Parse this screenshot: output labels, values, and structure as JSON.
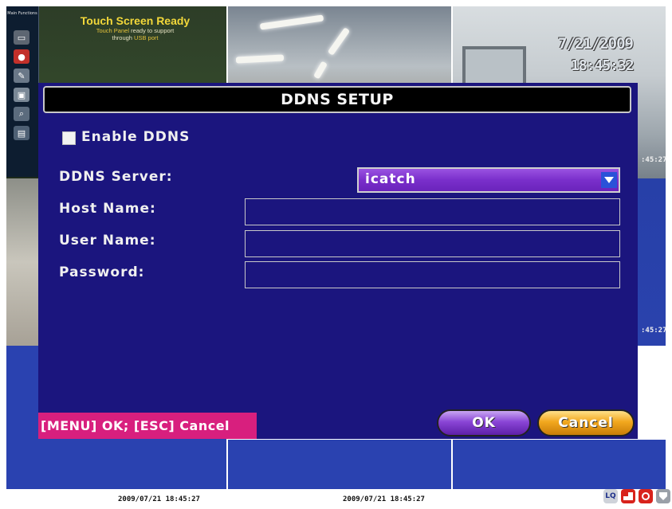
{
  "background": {
    "touch_panel": {
      "title": "Touch Screen Ready",
      "subtitle_line1_pre": "Touch Panel",
      "subtitle_line1_post": " ready to support",
      "subtitle_line2_pre": "through ",
      "subtitle_line2_usb": "USB port"
    },
    "side_panel_title": "Main Functions",
    "camera_date": "7/21/2009",
    "camera_time": "18:45:32",
    "partial_stamp_1": ":45:27",
    "partial_stamp_2": ":45:27",
    "bottom_stamp_1": "2009/07/21 18:45:27",
    "bottom_stamp_2": "2009/07/21 18:45:27",
    "status_lq": "LQ",
    "colors": {
      "dialog_bg": "#1b157e",
      "hint_bg": "#d81f7e",
      "select_bg": "#7a2fcb",
      "ok_button": "#8a45d6",
      "cancel_button": "#f2a81e"
    }
  },
  "dialog": {
    "title": "DDNS SETUP",
    "enable_ddns": {
      "label": "Enable DDNS",
      "checked": false
    },
    "ddns_server": {
      "label": "DDNS Server:",
      "value": "icatch"
    },
    "host_name": {
      "label": "Host Name:",
      "value": ""
    },
    "user_name": {
      "label": "User Name:",
      "value": ""
    },
    "password": {
      "label": "Password:",
      "value": ""
    },
    "hint": "[MENU] OK; [ESC] Cancel",
    "ok_label": "OK",
    "cancel_label": "Cancel"
  }
}
